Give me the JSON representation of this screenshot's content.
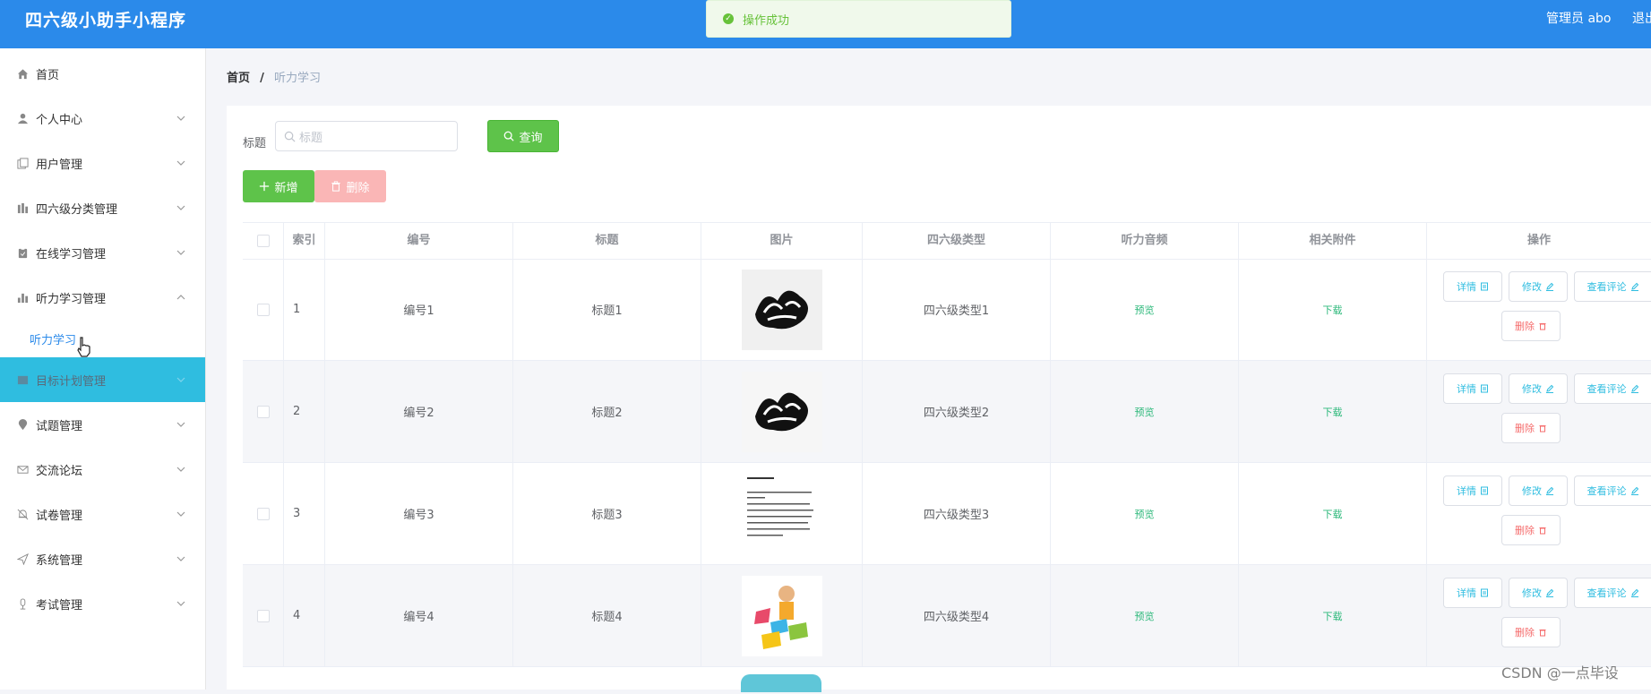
{
  "app": {
    "title": "四六级小助手小程序",
    "admin": "管理员 abo",
    "logout": "退出"
  },
  "toast": {
    "message": "操作成功"
  },
  "sidebar": {
    "items": [
      {
        "label": "首页",
        "icon": "home-icon"
      },
      {
        "label": "个人中心",
        "icon": "user-icon"
      },
      {
        "label": "用户管理",
        "icon": "copy-icon"
      },
      {
        "label": "四六级分类管理",
        "icon": "chart-icon"
      },
      {
        "label": "在线学习管理",
        "icon": "clipboard-icon"
      },
      {
        "label": "听力学习管理",
        "icon": "bar-chart-icon"
      },
      {
        "label": "目标计划管理",
        "icon": "grid-icon"
      },
      {
        "label": "试题管理",
        "icon": "location-icon"
      },
      {
        "label": "交流论坛",
        "icon": "mail-icon"
      },
      {
        "label": "试卷管理",
        "icon": "bell-icon"
      },
      {
        "label": "系统管理",
        "icon": "send-icon"
      },
      {
        "label": "考试管理",
        "icon": "mic-icon"
      }
    ],
    "submenu": {
      "label": "听力学习"
    },
    "active_index": 6
  },
  "breadcrumb": {
    "home": "首页",
    "separator": "/",
    "current": "听力学习"
  },
  "search": {
    "label": "标题",
    "placeholder": "标题",
    "query_label": "查询"
  },
  "actions": {
    "add_label": "新增",
    "delete_label": "删除"
  },
  "table": {
    "headers": [
      "索引",
      "编号",
      "标题",
      "图片",
      "四六级类型",
      "听力音频",
      "相关附件",
      "操作"
    ],
    "rows": [
      {
        "index": "1",
        "code": "编号1",
        "title": "标题1",
        "image": "stay-original-logo",
        "type": "四六级类型1",
        "audio": "预览",
        "attachment": "下载"
      },
      {
        "index": "2",
        "code": "编号2",
        "title": "标题2",
        "image": "stay-original-logo",
        "type": "四六级类型2",
        "audio": "预览",
        "attachment": "下载"
      },
      {
        "index": "3",
        "code": "编号3",
        "title": "标题3",
        "image": "text-document",
        "type": "四六级类型3",
        "audio": "预览",
        "attachment": "下载"
      },
      {
        "index": "4",
        "code": "编号4",
        "title": "标题4",
        "image": "happy-english",
        "type": "四六级类型4",
        "audio": "预览",
        "attachment": "下载"
      }
    ],
    "row_actions": {
      "detail": "详情",
      "edit": "修改",
      "review": "查看评论",
      "delete": "删除"
    }
  },
  "watermark": "CSDN @一点毕设",
  "colors": {
    "header": "#2b8aea",
    "active_menu": "#2fbde0",
    "green_button": "#5ec34a",
    "delete_button": "#fab6b6",
    "link_green": "#2cb87a"
  }
}
